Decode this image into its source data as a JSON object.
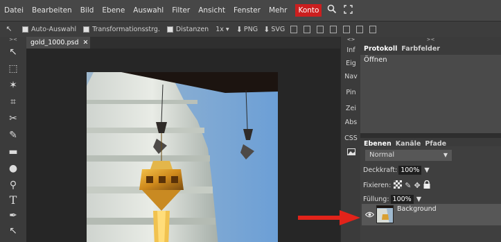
{
  "menu": {
    "items": [
      "Datei",
      "Bearbeiten",
      "Bild",
      "Ebene",
      "Auswahl",
      "Filter",
      "Ansicht",
      "Fenster",
      "Mehr"
    ],
    "highlight": "Konto",
    "icons": [
      "search-icon",
      "fullscreen-icon"
    ]
  },
  "options": {
    "auto_select": "Auto-Auswahl",
    "transform": "Transformationsstrg.",
    "distances": "Distanzen",
    "zoom": "1x",
    "png": "PNG",
    "svg": "SVG"
  },
  "document": {
    "tab_title": "gold_1000.psd",
    "close_symbol": "✕"
  },
  "side_strip": {
    "items": [
      "Inf",
      "Eig",
      "Nav",
      "Pin",
      "Zei",
      "Abs",
      "CSS"
    ]
  },
  "history_panel": {
    "tabs": [
      "Protokoll",
      "Farbfelder"
    ],
    "items": [
      "Öffnen"
    ]
  },
  "layers_panel": {
    "tabs": [
      "Ebenen",
      "Kanäle",
      "Pfade"
    ],
    "blend_mode": "Normal",
    "opacity_label": "Deckkraft:",
    "opacity_value": "100%",
    "lock_label": "Fixieren:",
    "fill_label": "Füllung:",
    "fill_value": "100%",
    "layer_name": "Background"
  },
  "colors": {
    "menubar": "#474747",
    "highlight": "#cc1f1f",
    "arrow": "#e2231a"
  }
}
